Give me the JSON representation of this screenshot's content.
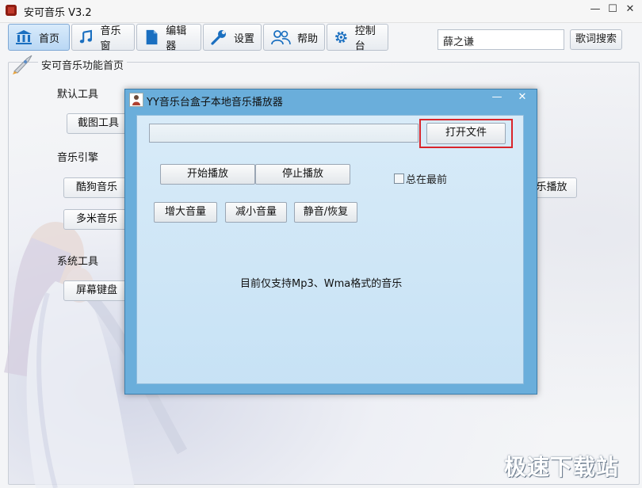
{
  "app": {
    "title": "安可音乐 V3.2"
  },
  "toolbar": {
    "tabs": [
      {
        "label": "首页",
        "icon": "bank-icon"
      },
      {
        "label": "音乐窗",
        "icon": "music-note-icon"
      },
      {
        "label": "编辑器",
        "icon": "document-icon"
      },
      {
        "label": "设置",
        "icon": "wrench-icon"
      },
      {
        "label": "帮助",
        "icon": "users-icon"
      },
      {
        "label": "控制台",
        "icon": "gear-icon"
      }
    ],
    "search_value": "薛之谦",
    "search_button": "歌词搜索"
  },
  "panel": {
    "title": "安可音乐功能首页",
    "sections": {
      "default_tools": "默认工具",
      "music_engine": "音乐引擎",
      "system_tools": "系统工具"
    },
    "buttons": {
      "screenshot": "截图工具",
      "kugou": "酷狗音乐",
      "duomi": "多米音乐",
      "screen_keyboard": "屏幕键盘",
      "music_play_fragment": "乐播放"
    }
  },
  "dialog": {
    "title": "YY音乐台盒子本地音乐播放器",
    "open_file": "打开文件",
    "start_play": "开始播放",
    "stop_play": "停止播放",
    "always_on_top": "总在最前",
    "volume_up": "增大音量",
    "volume_down": "减小音量",
    "mute": "静音/恢复",
    "info": "目前仅支持Mp3、Wma格式的音乐"
  },
  "watermark": "极速下载站",
  "colors": {
    "dialog_frame": "#6aaedb",
    "dialog_client": "#d8ebf8",
    "highlight": "#d9252b"
  }
}
